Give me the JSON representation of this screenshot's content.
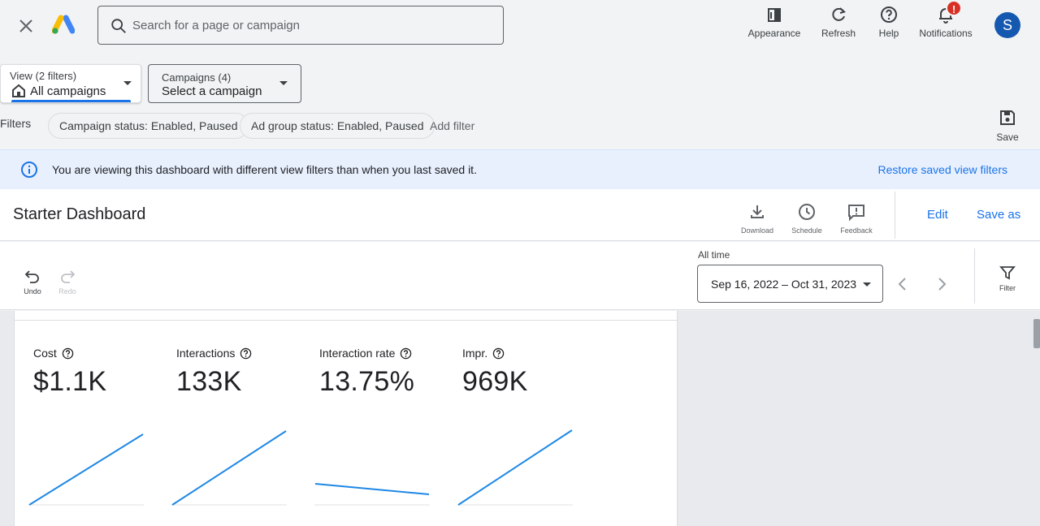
{
  "header": {
    "search_placeholder": "Search for a page or campaign",
    "tools": [
      {
        "label": "Appearance",
        "icon": "appearance-icon"
      },
      {
        "label": "Refresh",
        "icon": "refresh-icon"
      },
      {
        "label": "Help",
        "icon": "help-icon"
      },
      {
        "label": "Notifications",
        "icon": "bell-icon"
      }
    ],
    "notification_badge": "!",
    "avatar_initial": "S"
  },
  "selectors": {
    "view": {
      "small": "View (2 filters)",
      "big": "All campaigns"
    },
    "campaigns": {
      "small": "Campaigns (4)",
      "big": "Select a campaign"
    }
  },
  "filters": {
    "label": "Filters",
    "chips": [
      "Campaign status: Enabled, Paused",
      "Ad group status: Enabled, Paused"
    ],
    "add_filter": "Add filter",
    "save_label": "Save"
  },
  "banner": {
    "message": "You are viewing this dashboard with different view filters than when you last saved it.",
    "action": "Restore saved view filters"
  },
  "dashboard": {
    "title": "Starter Dashboard",
    "tools": [
      {
        "label": "Download",
        "icon": "download-icon"
      },
      {
        "label": "Schedule",
        "icon": "clock-icon"
      },
      {
        "label": "Feedback",
        "icon": "feedback-icon"
      }
    ],
    "edit_label": "Edit",
    "save_as_label": "Save as"
  },
  "toolbar": {
    "undo_label": "Undo",
    "redo_label": "Redo",
    "range_label": "All time",
    "range_value": "Sep 16, 2022 – Oct 31, 2023",
    "filter_label": "Filter"
  },
  "metrics": [
    {
      "name": "Cost",
      "value": "$1.1K"
    },
    {
      "name": "Interactions",
      "value": "133K"
    },
    {
      "name": "Interaction rate",
      "value": "13.75%"
    },
    {
      "name": "Impr.",
      "value": "969K"
    }
  ],
  "colors": {
    "accent": "#1a73e8",
    "sparkline": "#1e88e5",
    "banner_bg": "#e8f0fe",
    "badge": "#d93025",
    "avatar": "#1558b0"
  }
}
